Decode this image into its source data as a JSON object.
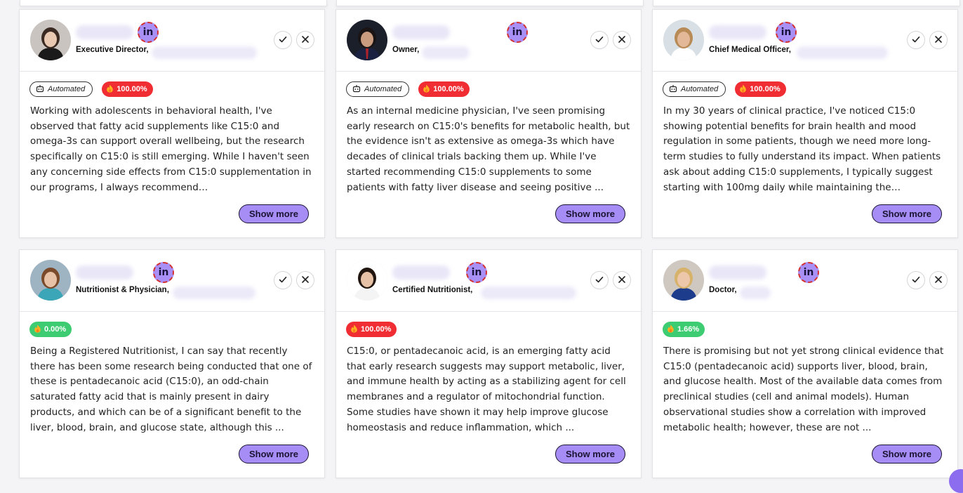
{
  "colors": {
    "accent": "#a68df5",
    "score_red": "#ef2d33",
    "score_green": "#3ecc73",
    "linkedin_badge": "#a990f6"
  },
  "labels": {
    "automated": "Automated",
    "show_more": "Show more",
    "linkedin": "in"
  },
  "icons": {
    "check": "check-icon",
    "close": "close-icon",
    "robot": "robot-icon",
    "flame": "flame-icon"
  },
  "cards": [
    {
      "role": "Executive Director,",
      "automated": true,
      "score": "100.00%",
      "score_color": "red",
      "text": "Working with adolescents in behavioral health, I've observed that fatty acid supplements like C15:0 and omega-3s can support overall wellbeing, but the research specifically on C15:0 is still emerging. While I haven't seen any concerning side effects from C15:0 supplementation in our programs, I always recommend…"
    },
    {
      "role": "Owner,",
      "automated": true,
      "score": "100.00%",
      "score_color": "red",
      "text": "As an internal medicine physician, I've seen promising early research on C15:0's benefits for metabolic health, but the evidence isn't as extensive as omega-3s which have decades of clinical trials backing them up. While I've started recommending C15:0 supplements to some patients with fatty liver disease and seeing positive ..."
    },
    {
      "role": "Chief Medical Officer,",
      "automated": true,
      "score": "100.00%",
      "score_color": "red",
      "text": "In my 30 years of clinical practice, I've noticed C15:0 showing potential benefits for brain health and mood regulation in some patients, though we need more long-term studies to fully understand its impact. When patients ask about adding C15:0 supplements, I typically suggest starting with 100mg daily while maintaining the…"
    },
    {
      "role": "Nutritionist & Physician,",
      "automated": false,
      "score": "0.00%",
      "score_color": "green",
      "text": "Being a Registered Nutritionist, I can say that recently there has been some research being conducted that one of these is pentadecanoic acid (C15:0), an odd-chain saturated fatty acid that is mainly present in dairy products, and which can be of a significant benefit to the liver, blood, brain, and glucose state, although this ..."
    },
    {
      "role": "Certified Nutritionist,",
      "automated": false,
      "score": "100.00%",
      "score_color": "red",
      "text": "C15:0, or pentadecanoic acid, is an emerging fatty acid that early research suggests may support metabolic, liver, and immune health by acting as a stabilizing agent for cell membranes and a regulator of mitochondrial function. Some studies have shown it may help improve glucose homeostasis and reduce inflammation, which ..."
    },
    {
      "role": "Doctor,",
      "automated": false,
      "score": "1.66%",
      "score_color": "green",
      "text": "There is promising but not yet strong clinical evidence that C15:0 (pentadecanoic acid) supports liver, blood, brain, and glucose health. Most of the available data comes from preclinical studies (cell and animal models). Human observational studies show a correlation with improved metabolic health; however, these are not ..."
    }
  ]
}
